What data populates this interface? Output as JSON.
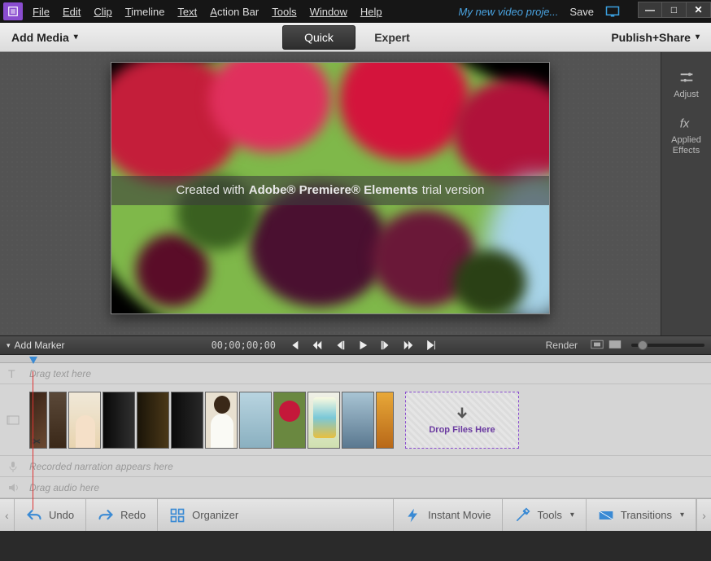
{
  "menu": {
    "file": "File",
    "edit": "Edit",
    "clip": "Clip",
    "timeline": "Timeline",
    "text": "Text",
    "action_bar": "Action Bar",
    "tools": "Tools",
    "window": "Window",
    "help": "Help"
  },
  "titlebar": {
    "project_name": "My new video proje...",
    "save": "Save"
  },
  "toolbar": {
    "add_media": "Add Media",
    "mode_quick": "Quick",
    "mode_expert": "Expert",
    "publish_share": "Publish+Share"
  },
  "right_panel": {
    "adjust": "Adjust",
    "applied_effects": "Applied Effects"
  },
  "watermark": {
    "prefix": "Created with",
    "brand": "Adobe® Premiere® Elements",
    "suffix": "trial version"
  },
  "transport": {
    "add_marker": "Add Marker",
    "timecode": "00;00;00;00",
    "render": "Render"
  },
  "timeline": {
    "text_hint": "Drag text here",
    "narration_hint": "Recorded narration appears here",
    "audio_hint": "Drag audio here",
    "drop_label": "Drop Files Here"
  },
  "bottombar": {
    "undo": "Undo",
    "redo": "Redo",
    "organizer": "Organizer",
    "instant_movie": "Instant Movie",
    "tools": "Tools",
    "transitions": "Transitions"
  }
}
